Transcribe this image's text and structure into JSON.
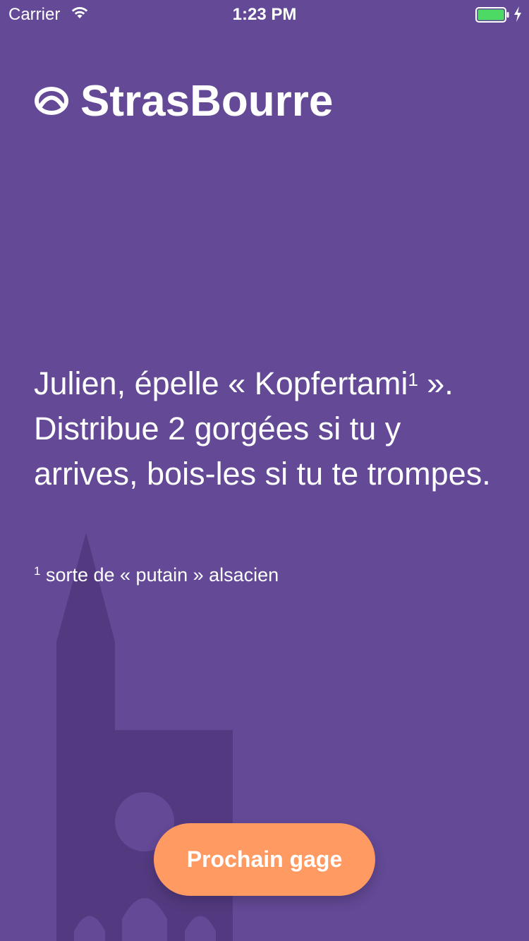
{
  "statusbar": {
    "carrier": "Carrier",
    "time": "1:23 PM",
    "wifi_icon": "wifi-icon",
    "battery_icon": "battery-icon",
    "battery_level": 1.0,
    "charging_icon": "charging-bolt-icon"
  },
  "brand": {
    "name": "StrasBourre",
    "logo_icon": "pretzel-icon"
  },
  "gage": {
    "text_before": "Julien, épelle « Kopfertami",
    "superscript": "1",
    "text_after": " ». Distribue 2 gorgées si tu y arrives, bois-les si tu te trompes."
  },
  "footnote": {
    "marker": "1",
    "text": " sorte de « putain » alsacien"
  },
  "actions": {
    "next_label": "Prochain gage"
  },
  "colors": {
    "background": "#634996",
    "cathedral_silhouette": "#533a80",
    "button": "#ff9a63",
    "battery": "#4cd964"
  }
}
